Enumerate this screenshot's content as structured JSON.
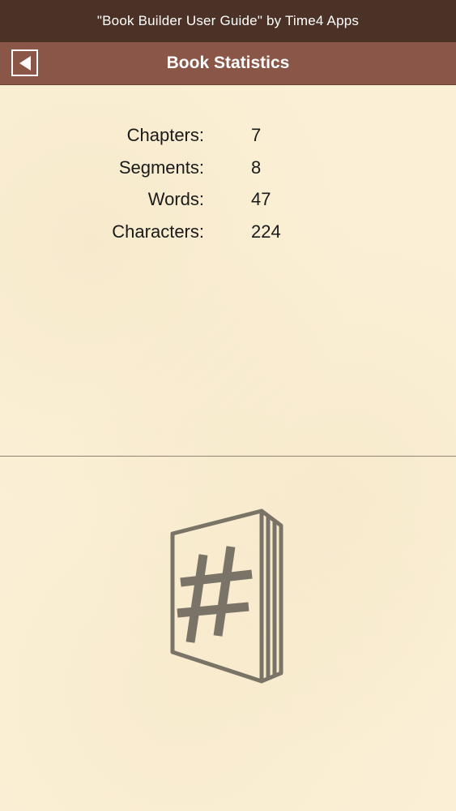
{
  "status_bar": {
    "title": "\"Book Builder User Guide\" by Time4 Apps"
  },
  "nav_bar": {
    "title": "Book Statistics",
    "back_icon": "back-arrow-icon"
  },
  "stats": [
    {
      "label": "Chapters:",
      "value": "7"
    },
    {
      "label": "Segments:",
      "value": "8"
    },
    {
      "label": "Words:",
      "value": "47"
    },
    {
      "label": "Characters:",
      "value": "224"
    }
  ],
  "illustration": {
    "icon": "book-hash-icon",
    "color": "#7a7468"
  },
  "colors": {
    "status_bar": "#4b3126",
    "nav_bar": "#8a5647",
    "background": "#fbf0d6"
  }
}
